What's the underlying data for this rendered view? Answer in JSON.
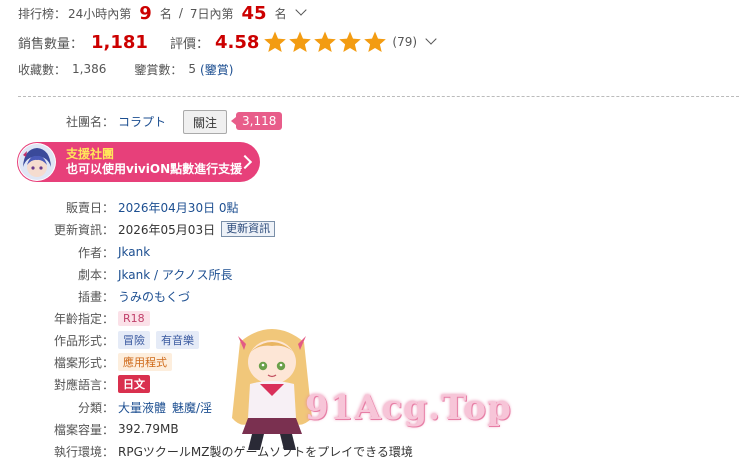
{
  "ranking": {
    "label": "排行榜：",
    "h24_prefix": "24小時內第",
    "h24_rank": "9",
    "h24_suffix": "名",
    "sep": "/",
    "d7_prefix": "7日內第",
    "d7_rank": "45",
    "d7_suffix": "名"
  },
  "sales": {
    "label": "銷售數量：",
    "value": "1,181",
    "rating_label": "評價：",
    "rating_value": "4.58",
    "rating_count": "(79)",
    "stars": 5
  },
  "collection": {
    "fav_label": "收藏數：",
    "fav_value": "1,386",
    "review_label": "鑒賞數：",
    "review_value": "5",
    "review_link": "(鑒賞)"
  },
  "circle": {
    "label": "社團名：",
    "name": "コラプト",
    "follow_label": "關注",
    "follow_count": "3,118"
  },
  "support": {
    "title": "支援社團",
    "subtitle": "也可以使用viviON點數進行支援"
  },
  "details": {
    "release_label": "販賣日：",
    "release_value": "2026年04月30日 0點",
    "update_label": "更新資訊：",
    "update_value": "2026年05月03日",
    "update_button": "更新資訊",
    "author_label": "作者：",
    "author_value": "Jkank",
    "script_label": "劇本：",
    "script_value": "Jkank / アクノス所長",
    "illust_label": "插畫：",
    "illust_value": "うみのもくづ",
    "age_label": "年齡指定：",
    "age_value": "R18",
    "form_label": "作品形式：",
    "form_tags": [
      "冒險",
      "有音樂"
    ],
    "file_label": "檔案形式：",
    "file_value": "應用程式",
    "lang_label": "對應語言：",
    "lang_value": "日文",
    "genre_label": "分類：",
    "genre_values": [
      "大量液體",
      "魅魔/淫"
    ],
    "size_label": "檔案容量：",
    "size_value": "392.79MB",
    "env_label": "執行環境：",
    "env_value": "RPGツクールMZ製のゲームソフトをプレイできる環境"
  },
  "watermark": "91Acg.Top",
  "colors": {
    "rank_red": "#cc0000",
    "star_orange": "#f39c12",
    "support_pink": "#e7407a",
    "follow_pink": "#e85d8a",
    "link_blue": "#1d4f91"
  }
}
